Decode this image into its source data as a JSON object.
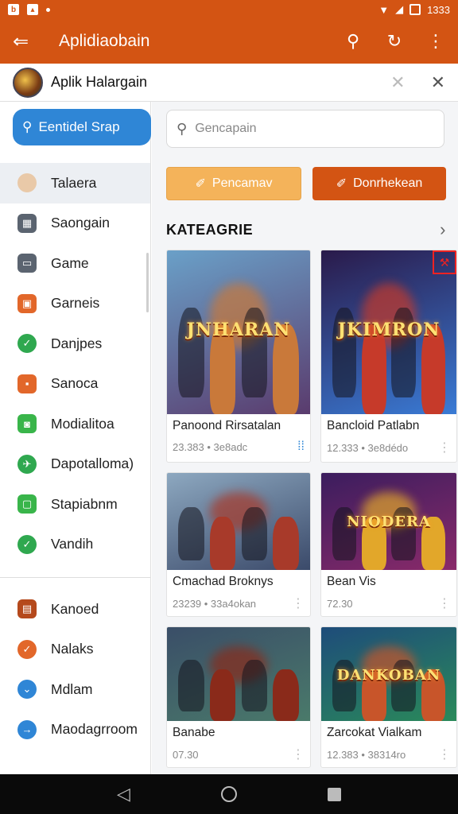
{
  "status_bar": {
    "time": "1333"
  },
  "app_bar": {
    "title": "Aplidiaobain"
  },
  "sub_bar": {
    "title": "Aplik Halargain"
  },
  "sidebar": {
    "search_label": "Eentidel Srap",
    "items": [
      {
        "label": "Talaera",
        "icon": "avatar-icon",
        "color": "#e9c9a8"
      },
      {
        "label": "Saongain",
        "icon": "calendar-icon",
        "color": "#5b6470"
      },
      {
        "label": "Game",
        "icon": "card-icon",
        "color": "#5b6470"
      },
      {
        "label": "Garneis",
        "icon": "tv-icon",
        "color": "#e2672a"
      },
      {
        "label": "Danjpes",
        "icon": "check-icon",
        "color": "#2fa84f"
      },
      {
        "label": "Sanoca",
        "icon": "bag-icon",
        "color": "#e2672a"
      },
      {
        "label": "Modialitoa",
        "icon": "android-icon",
        "color": "#39b54a"
      },
      {
        "label": "Dapotalloma)",
        "icon": "pin-icon",
        "color": "#2fa84f"
      },
      {
        "label": "Stapiabnm",
        "icon": "window-icon",
        "color": "#39b54a"
      },
      {
        "label": "Vandih",
        "icon": "check-circle-icon",
        "color": "#2fa84f"
      }
    ],
    "items_bottom": [
      {
        "label": "Kanoed",
        "icon": "frame-icon",
        "color": "#b5491c"
      },
      {
        "label": "Nalaks",
        "icon": "check-orange-icon",
        "color": "#e2672a"
      },
      {
        "label": "Mdlam",
        "icon": "chevron-circle-icon",
        "color": "#2f86d6"
      },
      {
        "label": "Maodagrroom",
        "icon": "arrow-circle-icon",
        "color": "#2f86d6"
      }
    ]
  },
  "main": {
    "search_placeholder": "Gencapain",
    "button_primary": "Pencamav",
    "button_secondary": "Donrhekean",
    "section_title": "KATEAGRIE",
    "cards": [
      {
        "name": "Panoond Rirsatalan",
        "meta": "23.383 • 3e8adc",
        "thumb_logo": "JNHARAN",
        "more": "blue"
      },
      {
        "name": "Bancloid Patlabn",
        "meta": "12.333 • 3e8dédo",
        "thumb_logo": "JKIMRON",
        "more": "grey"
      },
      {
        "name": "Cmachad Broknys",
        "meta": "23239 • 33a4okan",
        "thumb_logo": "",
        "more": "grey"
      },
      {
        "name": "Bean Vis",
        "meta": "72.30",
        "thumb_logo": "NIODERA",
        "more": "grey"
      },
      {
        "name": "Banabe",
        "meta": "07.30",
        "thumb_logo": "",
        "more": "grey"
      },
      {
        "name": "Zarcokat Vialkam",
        "meta": "12.383 • 38314ro",
        "thumb_logo": "DANKOBAN",
        "more": "grey"
      }
    ]
  },
  "colors": {
    "accent": "#d35413",
    "blue": "#2f86d6",
    "orange_light": "#f4b35a"
  }
}
